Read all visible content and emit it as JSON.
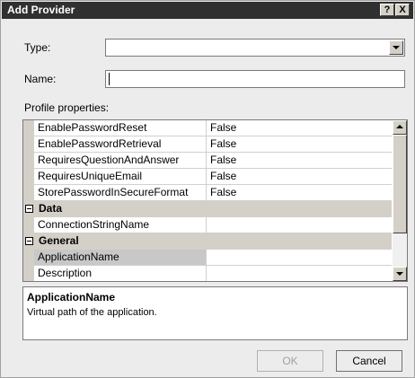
{
  "window": {
    "title": "Add Provider",
    "help_label": "?",
    "close_label": "X"
  },
  "form": {
    "type_label": "Type:",
    "type_value": "",
    "name_label": "Name:",
    "name_value": "",
    "profile_label": "Profile properties:"
  },
  "grid": {
    "rows": [
      {
        "kind": "prop",
        "name": "EnablePasswordReset",
        "value": "False"
      },
      {
        "kind": "prop",
        "name": "EnablePasswordRetrieval",
        "value": "False"
      },
      {
        "kind": "prop",
        "name": "RequiresQuestionAndAnswer",
        "value": "False"
      },
      {
        "kind": "prop",
        "name": "RequiresUniqueEmail",
        "value": "False"
      },
      {
        "kind": "prop",
        "name": "StorePasswordInSecureFormat",
        "value": "False"
      },
      {
        "kind": "category",
        "name": "Data"
      },
      {
        "kind": "prop",
        "name": "ConnectionStringName",
        "value": ""
      },
      {
        "kind": "category",
        "name": "General"
      },
      {
        "kind": "prop",
        "name": "ApplicationName",
        "value": "",
        "selected": true
      },
      {
        "kind": "prop",
        "name": "Description",
        "value": ""
      }
    ]
  },
  "description": {
    "title": "ApplicationName",
    "text": "Virtual path of the application."
  },
  "buttons": {
    "ok_label": "OK",
    "cancel_label": "Cancel"
  },
  "icons": {
    "combo_arrow": "chevron-down-icon",
    "scroll_up": "arrow-up-icon",
    "scroll_down": "arrow-down-icon",
    "expander": "collapse-minus-icon"
  }
}
